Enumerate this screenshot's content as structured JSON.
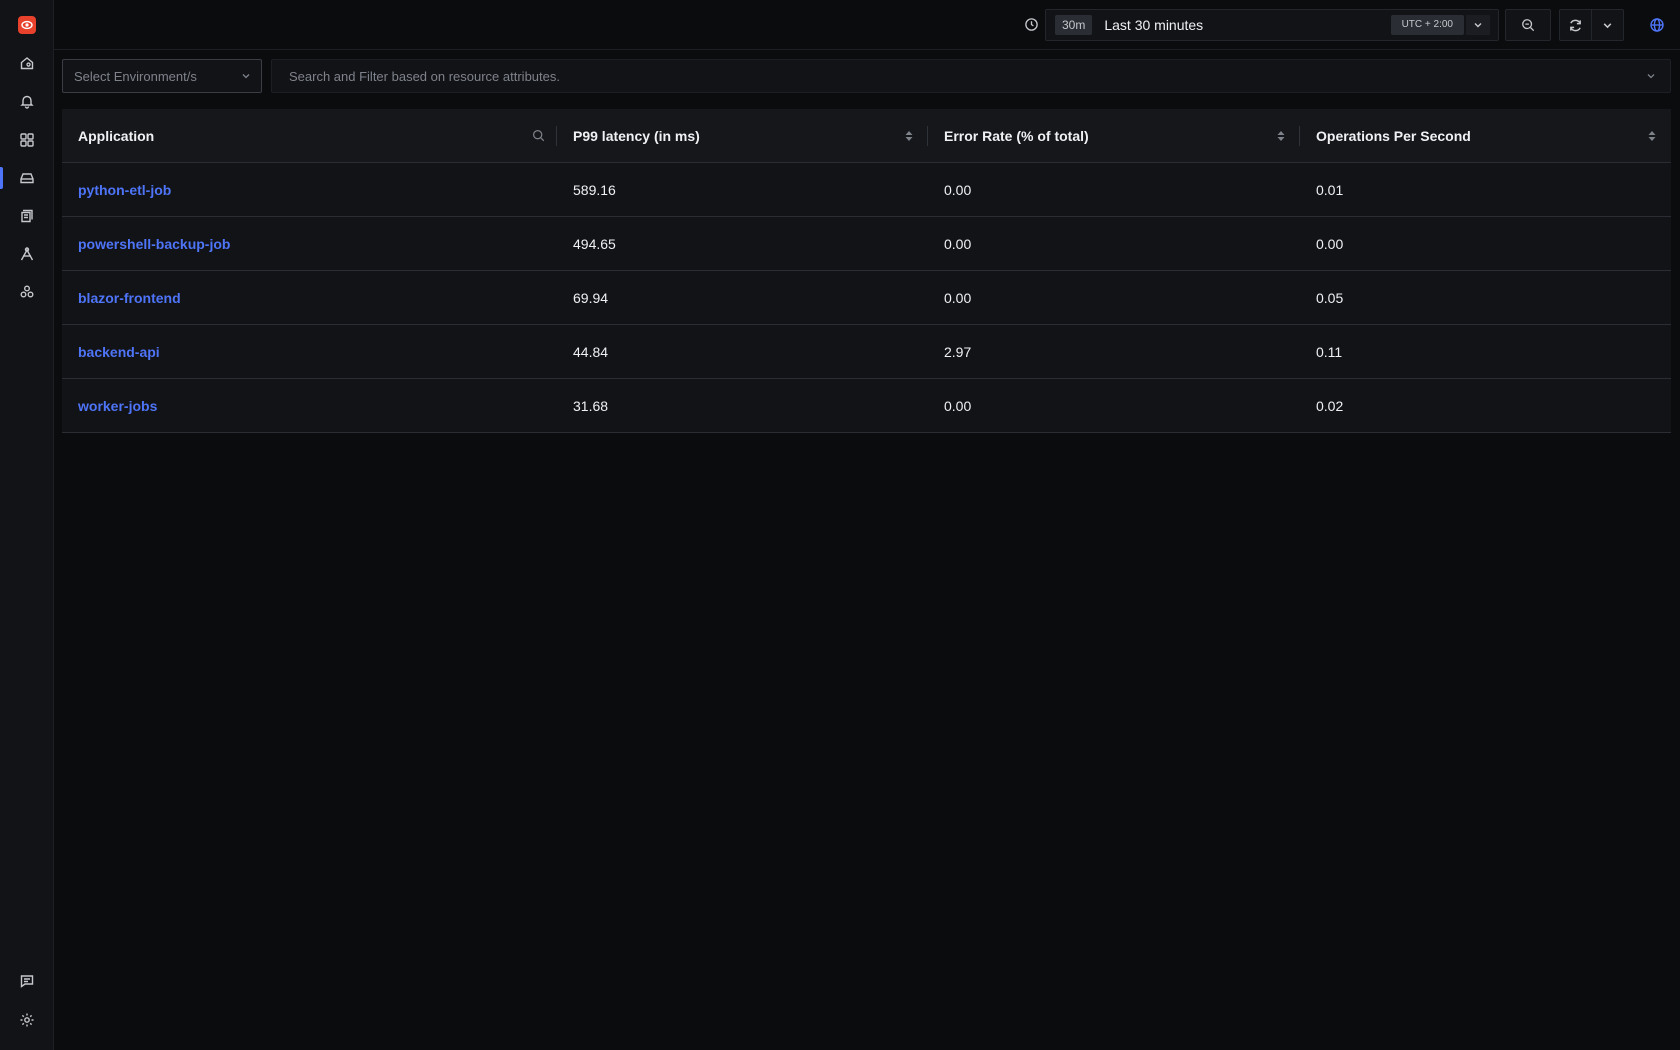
{
  "sidebar": {
    "items": [
      {
        "name": "home-icon"
      },
      {
        "name": "alerts-icon"
      },
      {
        "name": "dashboards-icon"
      },
      {
        "name": "services-icon"
      },
      {
        "name": "logs-icon"
      },
      {
        "name": "traces-icon"
      },
      {
        "name": "integrations-icon"
      },
      {
        "name": "feedback-icon"
      },
      {
        "name": "settings-icon"
      }
    ],
    "active_color": "#4E74F8"
  },
  "topbar": {
    "time_chip": "30m",
    "time_range": "Last 30 minutes",
    "timezone": "UTC + 2:00"
  },
  "filters": {
    "environment_placeholder": "Select Environment/s",
    "search_placeholder": "Search and Filter based on resource attributes."
  },
  "table": {
    "columns": [
      "Application",
      "P99 latency (in ms)",
      "Error Rate (% of total)",
      "Operations Per Second"
    ],
    "rows": [
      {
        "application": "python-etl-job",
        "p99": "589.16",
        "error_rate": "0.00",
        "ops": "0.01"
      },
      {
        "application": "powershell-backup-job",
        "p99": "494.65",
        "error_rate": "0.00",
        "ops": "0.00"
      },
      {
        "application": "blazor-frontend",
        "p99": "69.94",
        "error_rate": "0.00",
        "ops": "0.05"
      },
      {
        "application": "backend-api",
        "p99": "44.84",
        "error_rate": "2.97",
        "ops": "0.11"
      },
      {
        "application": "worker-jobs",
        "p99": "31.68",
        "error_rate": "0.00",
        "ops": "0.02"
      }
    ]
  },
  "colors": {
    "link": "#4E74F8",
    "brand": "#E8412C",
    "background": "#0B0C0E"
  }
}
